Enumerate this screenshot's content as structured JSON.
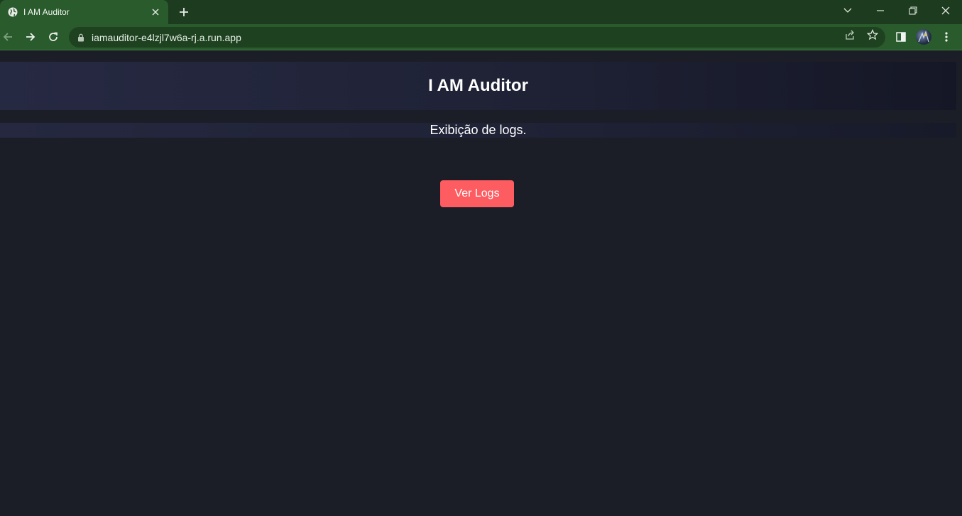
{
  "browser": {
    "tab": {
      "title": "I AM Auditor",
      "favicon": "globe-icon"
    },
    "url": "iamauditor-e4lzjl7w6a-rj.a.run.app",
    "colors": {
      "chrome": "#2a5b2c",
      "tabbar": "#1d3b1e"
    }
  },
  "page": {
    "title": "I AM Auditor",
    "subtitle": "Exibição de logs.",
    "button_label": "Ver Logs",
    "colors": {
      "background": "#1b1d27",
      "button": "#fd5c61",
      "text": "#ffffff"
    }
  }
}
